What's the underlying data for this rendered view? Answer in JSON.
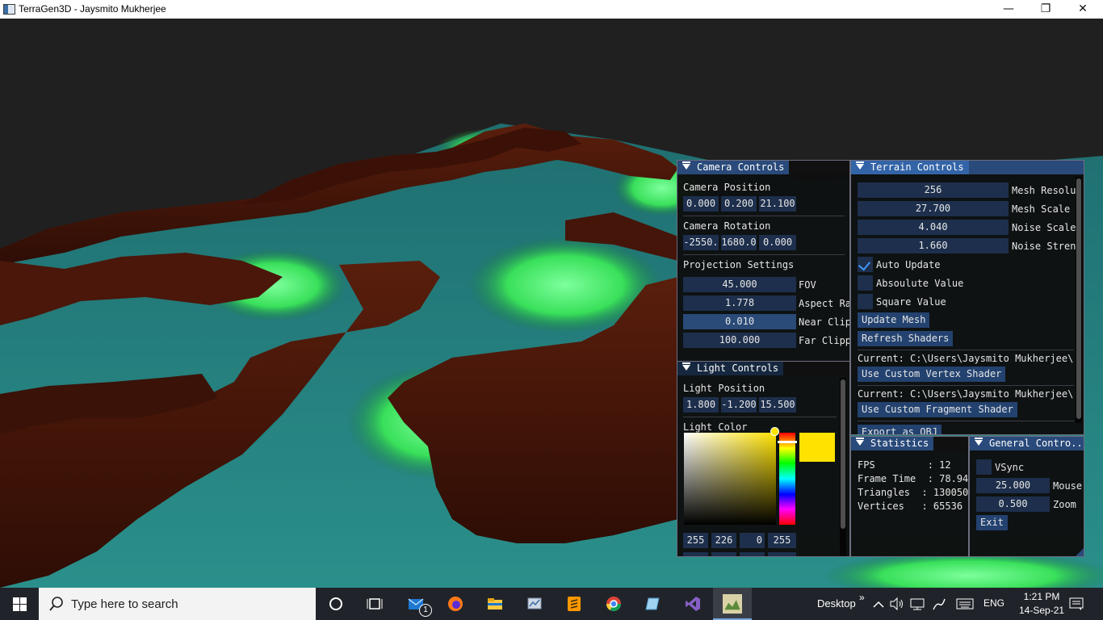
{
  "window": {
    "title": "TerraGen3D - Jaysmito Mukherjee",
    "minimize": "—",
    "maximize": "❐",
    "close": "✕"
  },
  "camera_controls": {
    "title": "Camera Controls",
    "position_label": "Camera Position",
    "position": [
      "0.000",
      "0.200",
      "21.100"
    ],
    "rotation_label": "Camera Rotation",
    "rotation": [
      "-2550.",
      "1680.0",
      "0.000"
    ],
    "projection_label": "Projection Settings",
    "fov": {
      "value": "45.000",
      "label": "FOV"
    },
    "aspect": {
      "value": "1.778",
      "label": "Aspect Ra"
    },
    "near": {
      "value": "0.010",
      "label": "Near Clip"
    },
    "far": {
      "value": "100.000",
      "label": "Far Clipp"
    }
  },
  "light_controls": {
    "title": "Light Controls",
    "position_label": "Light Position",
    "position": [
      "1.800",
      "-1.200",
      "15.500"
    ],
    "color_label": "Light Color",
    "rgba": [
      "255",
      "226",
      "0",
      "255"
    ],
    "color_hex": "#ffe200"
  },
  "terrain_controls": {
    "title": "Terrain Controls",
    "mesh_resolution": {
      "value": "256",
      "label": "Mesh Resolu"
    },
    "mesh_scale": {
      "value": "27.700",
      "label": "Mesh Scale"
    },
    "noise_scale": {
      "value": "4.040",
      "label": "Noise Scale"
    },
    "noise_strength": {
      "value": "1.660",
      "label": "Noise Stren"
    },
    "auto_update": {
      "label": "Auto Update",
      "checked": true
    },
    "absolute_value": {
      "label": "Absoulute Value",
      "checked": false
    },
    "square_value": {
      "label": "Square Value",
      "checked": false
    },
    "update_mesh": "Update Mesh",
    "refresh_shaders": "Refresh Shaders",
    "vertex_current": "Current: C:\\Users\\Jaysmito Mukherjee\\D",
    "use_vertex": "Use Custom Vertex Shader",
    "fragment_current": "Current: C:\\Users\\Jaysmito Mukherjee\\D",
    "use_fragment": "Use Custom Fragment Shader",
    "export_obj": "Export as OBJ"
  },
  "statistics": {
    "title": "Statistics",
    "fps": "FPS         : 12",
    "frame_time": "Frame Time  : 78.94",
    "triangles": "Triangles  : 130050",
    "vertices": "Vertices   : 65536"
  },
  "general_controls": {
    "title": "General Contro...",
    "vsync": {
      "label": "VSync",
      "checked": false
    },
    "mouse": {
      "value": "25.000",
      "label": "Mouse"
    },
    "zoom": {
      "value": "0.500",
      "label": "Zoom"
    },
    "exit": "Exit"
  },
  "taskbar": {
    "search_placeholder": "Type here to search",
    "mail_badge": "1",
    "desktop_label": "Desktop",
    "chevron": "»",
    "language": "ENG",
    "time": "1:21 PM",
    "date": "14-Sep-21"
  },
  "colors": {
    "accent": "#294a7a",
    "frame_bg": "#1d2f4c",
    "button": "#23426f",
    "taskbar": "#20242a"
  }
}
